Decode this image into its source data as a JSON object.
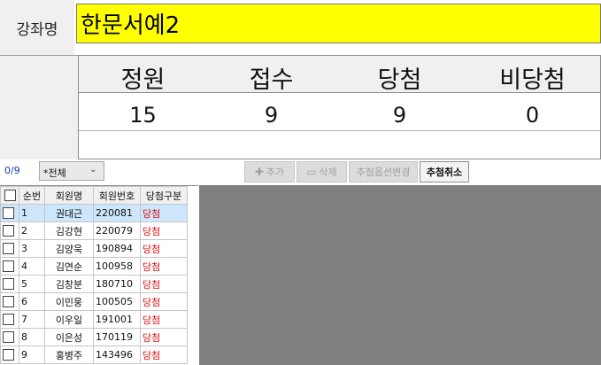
{
  "course": {
    "label": "강좌명",
    "name": "한문서예2"
  },
  "stats": {
    "headers": [
      "정원",
      "접수",
      "당첨",
      "비당첨"
    ],
    "values": [
      "15",
      "9",
      "9",
      "0"
    ]
  },
  "toolbar": {
    "count": "0/9",
    "filter_value": "*전체",
    "add_label": "추가",
    "delete_label": "삭제",
    "change_option_label": "추첨옵션변경",
    "cancel_draw_label": "추첨취소"
  },
  "grid": {
    "columns": [
      "",
      "순번",
      "회원명",
      "회원번호",
      "당첨구분"
    ],
    "rows": [
      {
        "no": "1",
        "name": "권대근",
        "id": "220081",
        "status": "당첨"
      },
      {
        "no": "2",
        "name": "김강현",
        "id": "220079",
        "status": "당첨"
      },
      {
        "no": "3",
        "name": "김양욱",
        "id": "190894",
        "status": "당첨"
      },
      {
        "no": "4",
        "name": "김연순",
        "id": "100958",
        "status": "당첨"
      },
      {
        "no": "5",
        "name": "김창분",
        "id": "180710",
        "status": "당첨"
      },
      {
        "no": "6",
        "name": "이민웅",
        "id": "100505",
        "status": "당첨"
      },
      {
        "no": "7",
        "name": "이우일",
        "id": "191001",
        "status": "당첨"
      },
      {
        "no": "8",
        "name": "이은성",
        "id": "170119",
        "status": "당첨"
      },
      {
        "no": "9",
        "name": "홍병주",
        "id": "143496",
        "status": "당첨"
      }
    ]
  },
  "colors": {
    "course_bg": "#ffff00",
    "status": "#e01010",
    "selected_row": "#cce6fb",
    "empty_area": "#808080"
  }
}
